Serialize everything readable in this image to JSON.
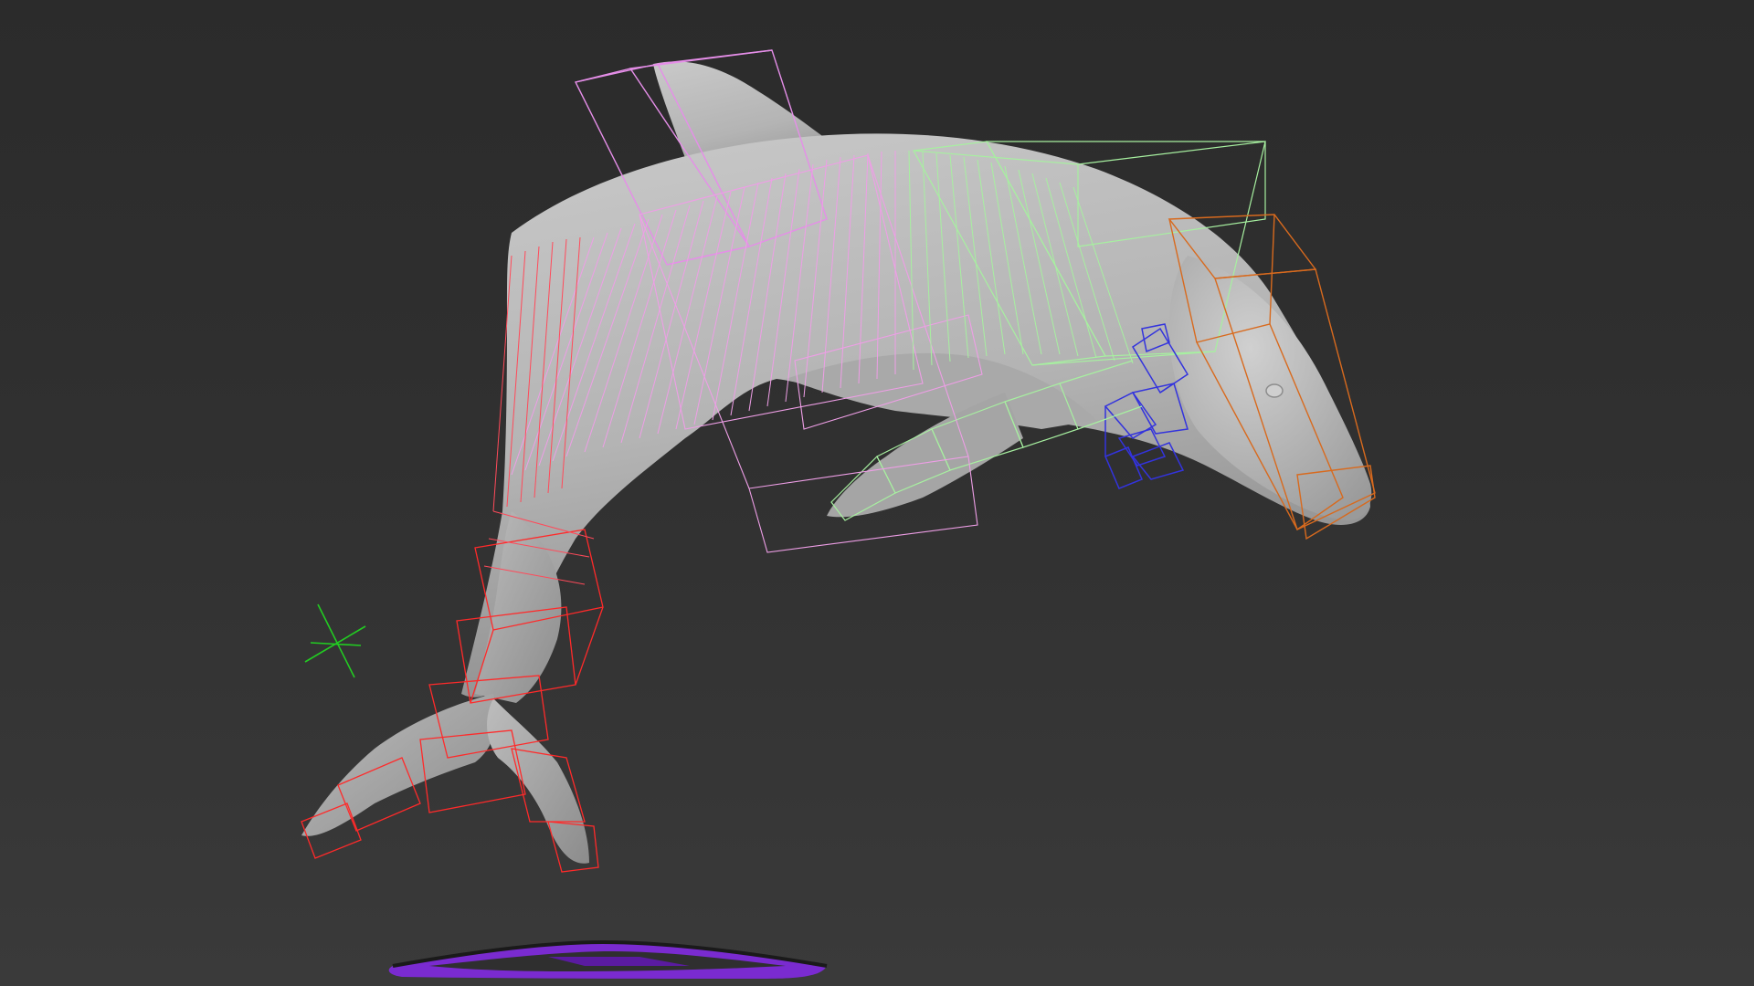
{
  "viewport": {
    "background_top": "#2b2b2b",
    "background_bottom": "#3a3a3a"
  },
  "scene": {
    "model": "dolphin",
    "mesh_color": "#b8b8b8",
    "bone_colors": {
      "dorsal_fin": "#e58ee8",
      "spine_front": "#a7f0a0",
      "spine_mid": "#ee9ee6",
      "tail": "#ff2a2a",
      "head": "#d86a1e",
      "flipper_right": "#3333dd",
      "flipper_left": "#a7f0a0"
    },
    "helper_color": "#22cc22",
    "ground_control_color": "#7a2bd0"
  }
}
